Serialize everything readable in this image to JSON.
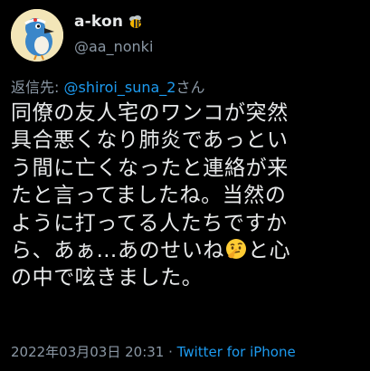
{
  "author": {
    "display_name": "a-kon",
    "handle": "@aa_nonki",
    "name_badge_icon": "bee-icon"
  },
  "reply": {
    "prefix": "返信先: ",
    "target": "@shiroi_suna_2",
    "suffix": "さん"
  },
  "tweet": {
    "lines": [
      "同僚の友人宅のワンコが突然",
      "具合悪くなり肺炎であっとい",
      "う間に亡くなったと連絡が来",
      "たと言ってましたね。当然の",
      "ように打ってる人たちですか"
    ],
    "line6_before_emoji": "ら、あぁ…あのせいね",
    "line6_emoji": "thinking-face-emoji",
    "line6_after_emoji": "と心",
    "line7": "の中で呟きました。"
  },
  "meta": {
    "timestamp": "2022年03月03日 20:31",
    "separator": " · ",
    "source": "Twitter for iPhone"
  },
  "colors": {
    "background": "#000000",
    "text": "#e7e9ea",
    "secondary": "#8b98a5",
    "link": "#1d9bf0"
  }
}
